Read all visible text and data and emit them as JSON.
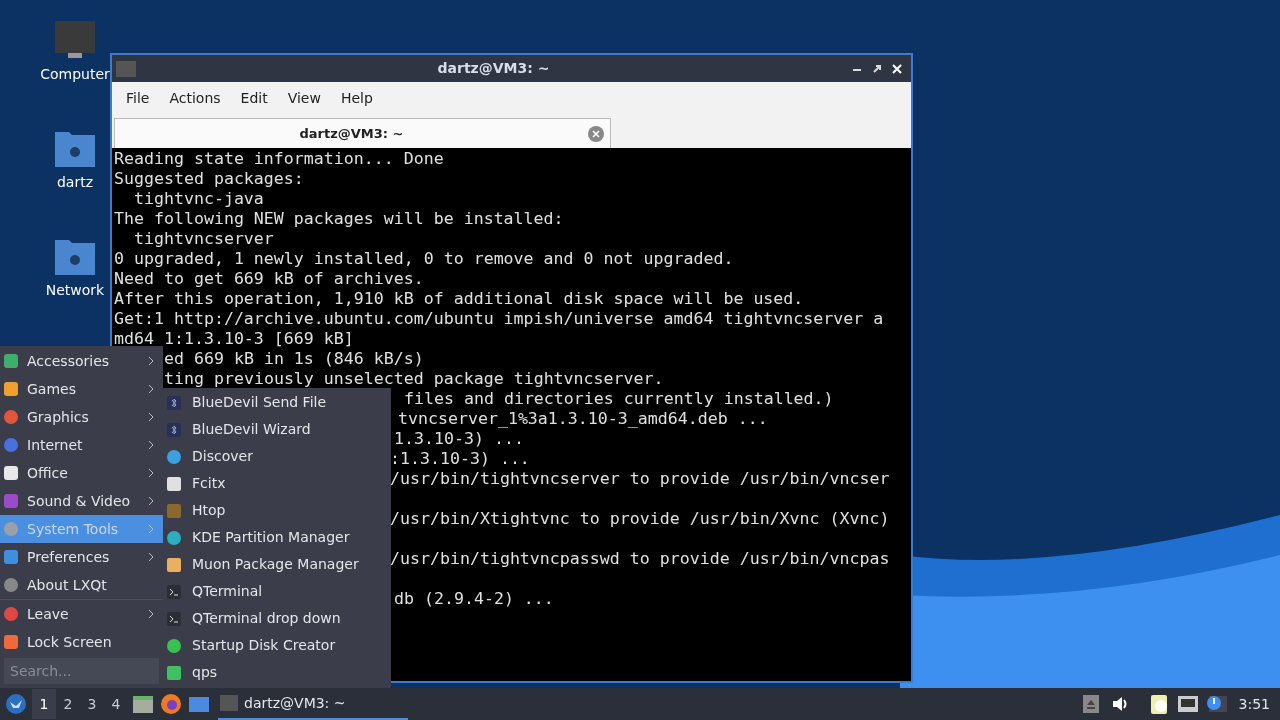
{
  "desktop_icons": [
    {
      "label": "Computer"
    },
    {
      "label": "dartz"
    },
    {
      "label": "Network"
    }
  ],
  "window": {
    "title": "dartz@VM3: ~",
    "menu": [
      "File",
      "Actions",
      "Edit",
      "View",
      "Help"
    ],
    "tab": "dartz@VM3: ~",
    "lines": [
      "Reading state information... Done",
      "Suggested packages:",
      "  tightvnc-java",
      "The following NEW packages will be installed:",
      "  tightvncserver",
      "0 upgraded, 1 newly installed, 0 to remove and 0 not upgraded.",
      "Need to get 669 kB of archives.",
      "After this operation, 1,910 kB of additional disk space will be used.",
      "Get:1 http://archive.ubuntu.com/ubuntu impish/universe amd64 tightvncserver a",
      "md64 1:1.3.10-3 [669 kB]",
      "ed 669 kB in 1s (846 kB/s)",
      "ting previously unselected package tightvncserver.",
      "files and directories currently installed.)",
      "tvncserver_1%3a1.3.10-3_amd64.deb ...",
      "1.3.10-3) ...",
      ":1.3.10-3) ...",
      "/usr/bin/tightvncserver to provide /usr/bin/vncser",
      "/usr/bin/Xtightvnc to provide /usr/bin/Xvnc (Xvnc)",
      "/usr/bin/tightvncpasswd to provide /usr/bin/vncpas",
      "db (2.9.4-2) ..."
    ]
  },
  "main_menu": {
    "items": [
      {
        "label": "Accessories",
        "has_submenu": true,
        "selected": false
      },
      {
        "label": "Games",
        "has_submenu": true,
        "selected": false
      },
      {
        "label": "Graphics",
        "has_submenu": true,
        "selected": false
      },
      {
        "label": "Internet",
        "has_submenu": true,
        "selected": false
      },
      {
        "label": "Office",
        "has_submenu": true,
        "selected": false
      },
      {
        "label": "Sound & Video",
        "has_submenu": true,
        "selected": false
      },
      {
        "label": "System Tools",
        "has_submenu": true,
        "selected": true
      },
      {
        "label": "Preferences",
        "has_submenu": true,
        "selected": false
      },
      {
        "label": "About LXQt",
        "has_submenu": false,
        "selected": false
      },
      {
        "label": "Leave",
        "has_submenu": true,
        "selected": false
      },
      {
        "label": "Lock Screen",
        "has_submenu": false,
        "selected": false
      }
    ],
    "search": {
      "placeholder": "Search..."
    }
  },
  "submenu": {
    "items": [
      "BlueDevil Send File",
      "BlueDevil Wizard",
      "Discover",
      "Fcitx",
      "Htop",
      "KDE Partition Manager",
      "Muon Package Manager",
      "QTerminal",
      "QTerminal drop down",
      "Startup Disk Creator",
      "qps"
    ]
  },
  "taskbar": {
    "desktops": [
      {
        "label": "1",
        "selected": true
      },
      {
        "label": "2",
        "selected": false
      },
      {
        "label": "3",
        "selected": false
      },
      {
        "label": "4",
        "selected": false
      }
    ],
    "task": {
      "label": "dartz@VM3: ~",
      "selected": true
    },
    "clock": "3:51"
  }
}
